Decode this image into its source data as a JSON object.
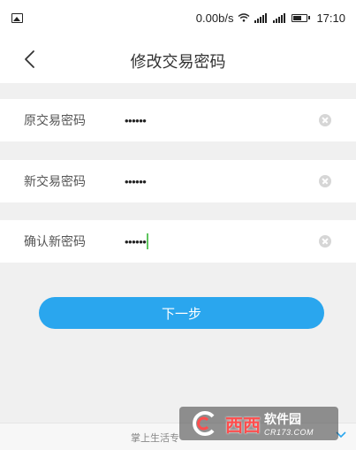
{
  "status_bar": {
    "network_speed": "0.00b/s",
    "time": "17:10",
    "icons": [
      "image-icon",
      "wifi-icon",
      "signal-icon",
      "signal-icon",
      "battery-icon"
    ]
  },
  "nav": {
    "title": "修改交易密码",
    "back_icon": "back-chevron-icon"
  },
  "form": {
    "rows": [
      {
        "label": "原交易密码",
        "value": "••••••"
      },
      {
        "label": "新交易密码",
        "value": "••••••"
      },
      {
        "label": "确认新密码",
        "value": "••••••"
      }
    ],
    "clear_icon": "clear-icon",
    "caret_color": "#5ec55e"
  },
  "next_button": {
    "label": "下一步",
    "color": "#2aa6ee"
  },
  "footer": {
    "text": "掌上生活专"
  },
  "watermark": {
    "brand": "西西",
    "name": "软件园",
    "url": "CR173.COM"
  }
}
